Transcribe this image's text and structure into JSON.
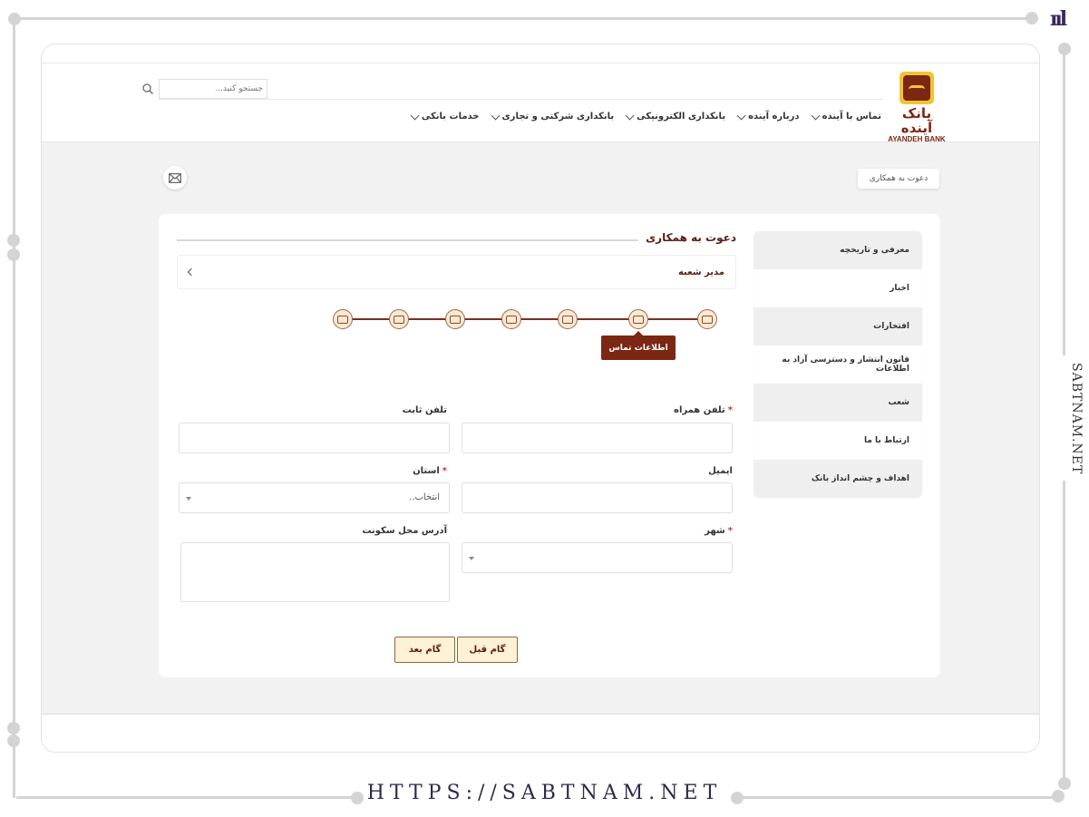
{
  "branding": {
    "side_text": "SABTNAM.NET",
    "url_text": "HTTPS://SABTNAM.NET",
    "mark": "ııl"
  },
  "bank": {
    "name_fa": "بانک آینده",
    "name_en": "AYANDEH BANK"
  },
  "search": {
    "placeholder": "جستجو کنید..."
  },
  "nav": {
    "items": [
      {
        "label": "خدمات بانکی"
      },
      {
        "label": "بانکداری شرکتی و تجاری"
      },
      {
        "label": "بانکداری الکترونیکی"
      },
      {
        "label": "درباره آینده"
      },
      {
        "label": "تماس با آینده"
      }
    ]
  },
  "breadcrumb": {
    "current": "دعوت به همکاری"
  },
  "sidebar": {
    "items": [
      {
        "label": "معرفی و تاریخچه"
      },
      {
        "label": "اخبار"
      },
      {
        "label": "افتخارات"
      },
      {
        "label": "قانون انتشار و دسترسی آزاد به اطلاعات"
      },
      {
        "label": "شعب"
      },
      {
        "label": "ارتباط با ما"
      },
      {
        "label": "اهداف و چشم انداز بانک"
      }
    ]
  },
  "form": {
    "title": "دعوت به همکاری",
    "position": "مدیر شعبه",
    "steps_count": 7,
    "active_step_label": "اطلاعات تماس",
    "fields": {
      "mobile": {
        "label": "تلفن همراه",
        "required": "*"
      },
      "phone": {
        "label": "تلفن ثابت"
      },
      "email": {
        "label": "ایمیل"
      },
      "province": {
        "label": "استان",
        "required": "*",
        "selected": "انتخاب.."
      },
      "city": {
        "label": "شهر",
        "required": "*"
      },
      "address": {
        "label": "آدرس محل سکونت"
      }
    },
    "buttons": {
      "prev": "گام قبل",
      "next": "گام بعد"
    }
  },
  "colors": {
    "brand": "#7b2714",
    "accent": "#f3c432",
    "button_bg": "#fdf1d6"
  }
}
